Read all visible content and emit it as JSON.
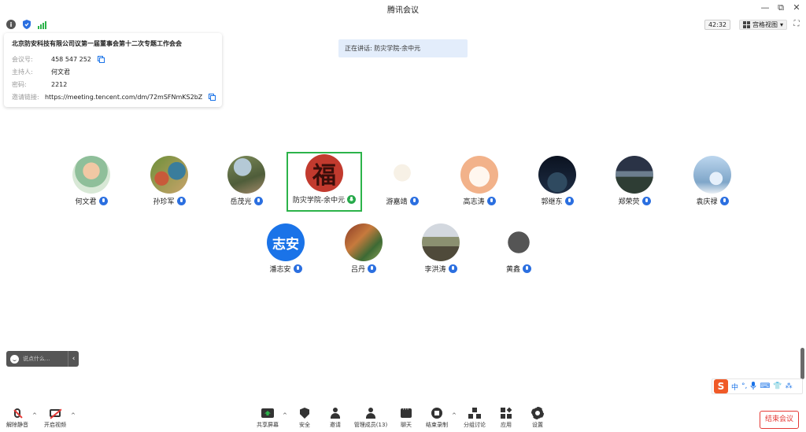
{
  "window": {
    "title": "腾讯会议",
    "minimize": "—",
    "restore": "⧉",
    "close": "✕"
  },
  "topbar": {
    "timer": "42:32",
    "view_label": "宫格视图",
    "view_caret": "▾",
    "fullscreen": "⛶"
  },
  "meeting_info": {
    "title": "北京防安科技有限公司议第一届董事会第十二次专题工作会会",
    "rows": [
      {
        "label": "会议号:",
        "value": "458 547 252",
        "copy": true
      },
      {
        "label": "主持人:",
        "value": "何文君",
        "copy": false
      },
      {
        "label": "密码:",
        "value": "2212",
        "copy": false
      },
      {
        "label": "邀请链接:",
        "value": "https://meeting.tencent.com/dm/72mSFNmKS2bZ",
        "copy": true
      }
    ]
  },
  "speaking": "正在讲话: 防灾学院-余中元",
  "participants": [
    {
      "name": "何文君"
    },
    {
      "name": "孙珍军"
    },
    {
      "name": "岳茂光"
    },
    {
      "name": "防灾学院-余中元",
      "avatar_text": "福",
      "speaking": true
    },
    {
      "name": "游嘉靖"
    },
    {
      "name": "高志涛"
    },
    {
      "name": "郭继东"
    },
    {
      "name": "郑荣荧"
    },
    {
      "name": "袁庆禄"
    },
    {
      "name": "潘志安",
      "avatar_text": "志安"
    },
    {
      "name": "吕丹"
    },
    {
      "name": "李洪涛"
    },
    {
      "name": "黄鑫"
    }
  ],
  "chat": {
    "placeholder": "说点什么...",
    "collapse": "‹"
  },
  "ime": {
    "logo": "S",
    "mode": "中",
    "punct": "°,",
    "keyboard": "⌨",
    "shirt": "👕",
    "grid": "⁂"
  },
  "toolbar": {
    "mute": "解除静音",
    "video": "开启视频",
    "share": "共享屏幕",
    "security": "安全",
    "invite": "邀请",
    "members": "管理成员(13)",
    "chat": "聊天",
    "record": "结束录制",
    "breakout": "分组讨论",
    "apps": "应用",
    "settings": "设置",
    "caret": "^"
  },
  "end_meeting": "结束会议",
  "colors": {
    "accent": "#2b6fe0",
    "speaking_border": "#2cb34a",
    "end_red": "#e53935",
    "speaking_banner": "#e3edfb"
  }
}
